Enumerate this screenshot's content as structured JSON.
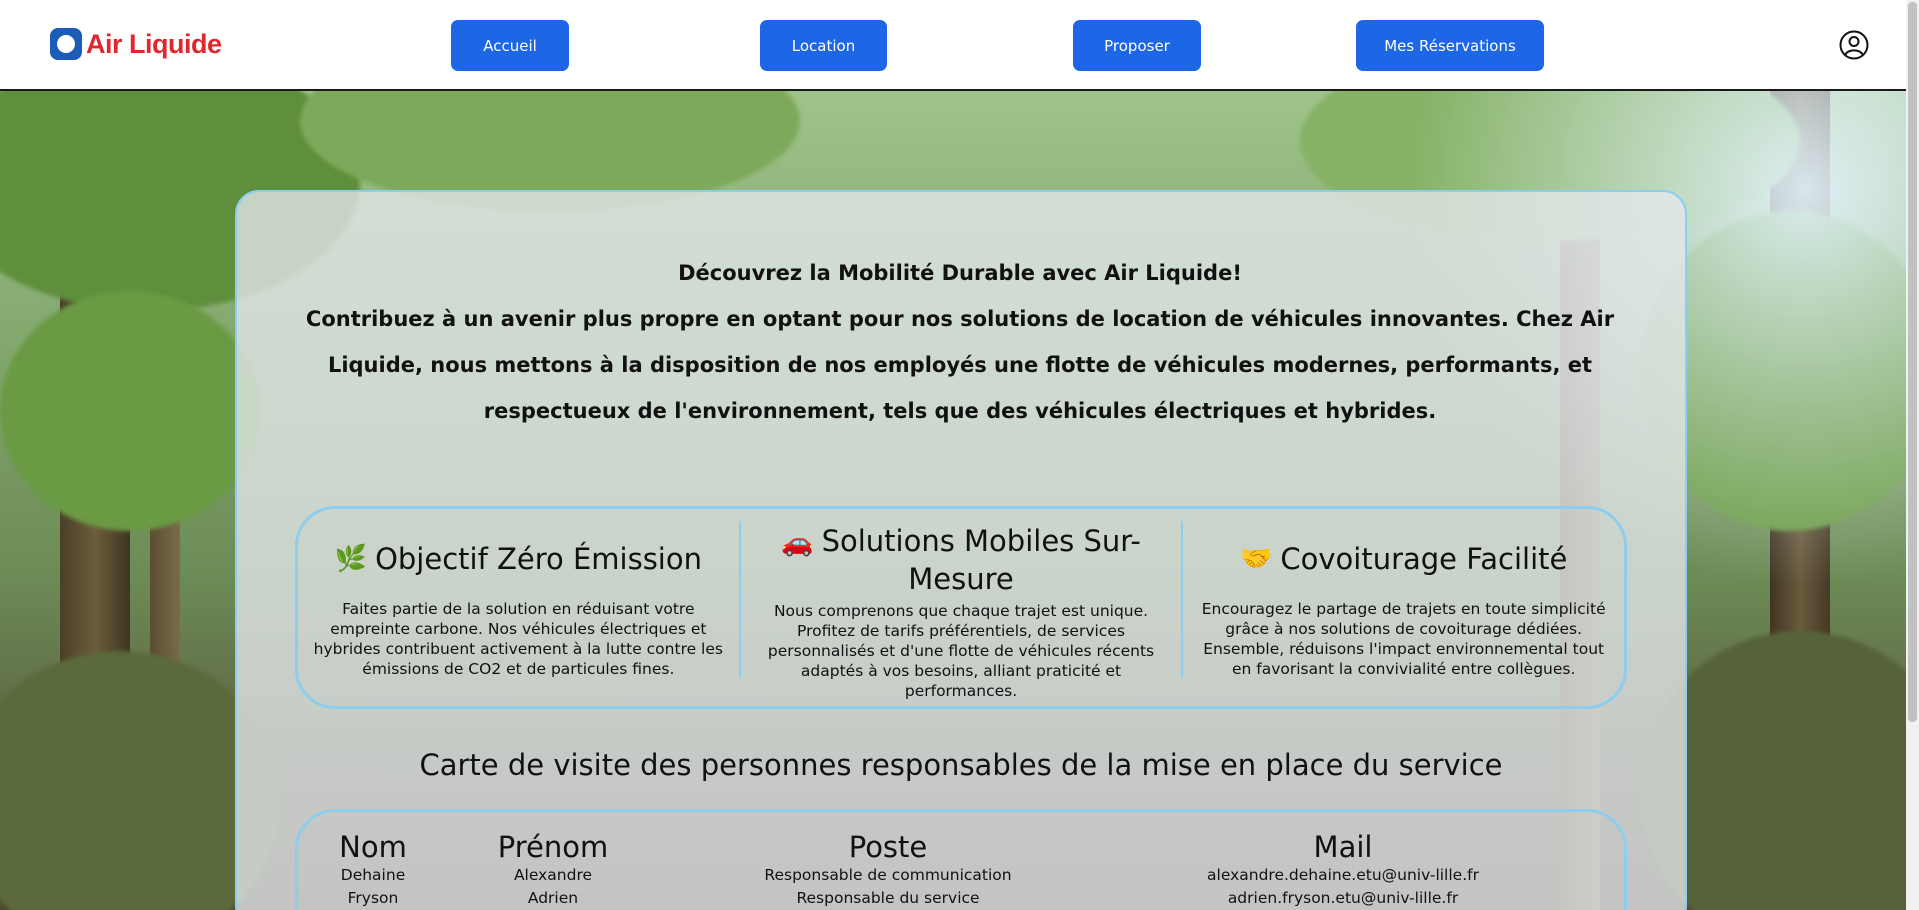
{
  "header": {
    "logo_text": "Air Liquide",
    "nav": [
      {
        "label": "Accueil"
      },
      {
        "label": "Location"
      },
      {
        "label": "Proposer"
      },
      {
        "label": "Mes Réservations"
      }
    ],
    "user_icon": "user-circle-icon"
  },
  "intro": {
    "title": "Découvrez la Mobilité Durable avec Air Liquide!",
    "body": "Contribuez à un avenir plus propre en optant pour nos solutions de location de véhicules innovantes. Chez Air Liquide, nous mettons à la disposition de nos employés une flotte de véhicules modernes, performants, et respectueux de l'environnement, tels que des véhicules électriques et hybrides."
  },
  "features": [
    {
      "emoji": "🌿",
      "title": "Objectif Zéro Émission",
      "text": "Faites partie de la solution en réduisant votre empreinte carbone. Nos véhicules électriques et hybrides contribuent activement à la lutte contre les émissions de CO2 et de particules fines."
    },
    {
      "emoji": "🚗",
      "title": "Solutions Mobiles Sur-Mesure",
      "text": "Nous comprenons que chaque trajet est unique. Profitez de tarifs préférentiels, de services personnalisés et d'une flotte de véhicules récents adaptés à vos besoins, alliant praticité et performances."
    },
    {
      "emoji": "🤝",
      "title": "Covoiturage Facilité",
      "text": "Encouragez le partage de trajets en toute simplicité grâce à nos solutions de covoiturage dédiées. Ensemble, réduisons l'impact environnemental tout en favorisant la convivialité entre collègues."
    }
  ],
  "team": {
    "title": "Carte de visite des personnes responsables de la mise en place du service",
    "headers": {
      "nom": "Nom",
      "prenom": "Prénom",
      "poste": "Poste",
      "mail": "Mail"
    },
    "rows": [
      {
        "nom": "Dehaine",
        "prenom": "Alexandre",
        "poste": "Responsable de communication",
        "mail": "alexandre.dehaine.etu@univ-lille.fr"
      },
      {
        "nom": "Fryson",
        "prenom": "Adrien",
        "poste": "Responsable du service",
        "mail": "adrien.fryson.etu@univ-lille.fr"
      }
    ]
  },
  "colors": {
    "nav_button": "#1d66e6",
    "logo_red": "#e0262f",
    "logo_blue": "#1d5bb8",
    "card_border": "#8ccdf0"
  }
}
